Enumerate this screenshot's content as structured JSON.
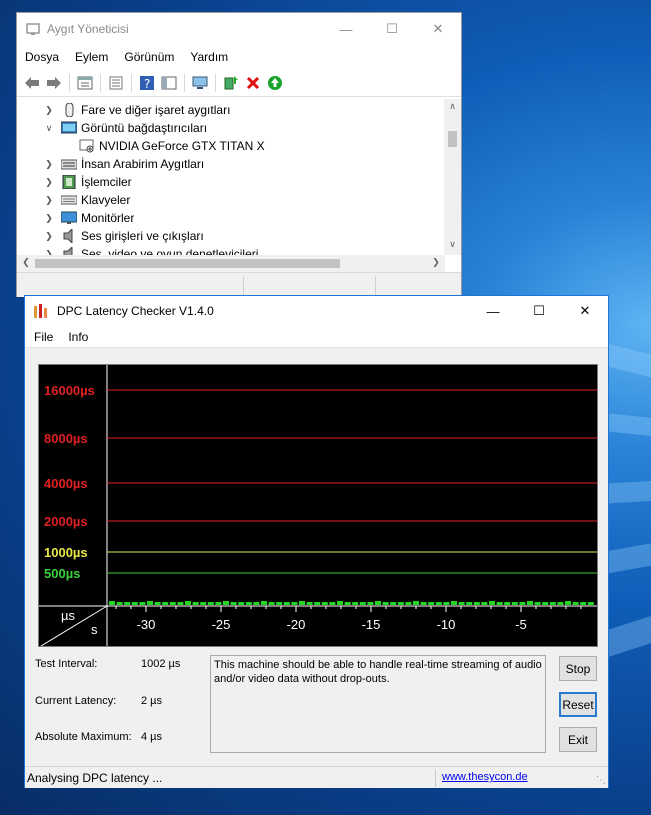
{
  "colors": {
    "accent": "#1d76d6",
    "grid_red": "#e02020",
    "grid_yellow": "#e8e84a",
    "grid_green": "#3ad13a",
    "bar_green": "#22d622"
  },
  "device_manager": {
    "title": "Aygıt Yöneticisi",
    "menu": [
      "Dosya",
      "Eylem",
      "Görünüm",
      "Yardım"
    ],
    "tree": [
      {
        "label": "Fare ve diğer işaret aygıtları",
        "expanded": false,
        "indent": 0,
        "icon": "mouse-icon"
      },
      {
        "label": "Görüntü bağdaştırıcıları",
        "expanded": true,
        "indent": 0,
        "icon": "display-adapter-icon"
      },
      {
        "label": "NVIDIA GeForce GTX TITAN X",
        "expanded": null,
        "indent": 1,
        "icon": "gpu-device-icon"
      },
      {
        "label": "İnsan Arabirim Aygıtları",
        "expanded": false,
        "indent": 0,
        "icon": "hid-icon"
      },
      {
        "label": "İşlemciler",
        "expanded": false,
        "indent": 0,
        "icon": "processor-icon"
      },
      {
        "label": "Klavyeler",
        "expanded": false,
        "indent": 0,
        "icon": "keyboard-icon"
      },
      {
        "label": "Monitörler",
        "expanded": false,
        "indent": 0,
        "icon": "monitor-icon"
      },
      {
        "label": "Ses girişleri ve çıkışları",
        "expanded": false,
        "indent": 0,
        "icon": "audio-icon"
      },
      {
        "label": "Ses, video ve oyun denetleyicileri",
        "expanded": false,
        "indent": 0,
        "icon": "speaker-icon"
      }
    ]
  },
  "dpc": {
    "title": "DPC Latency Checker V1.4.0",
    "menu": [
      "File",
      "Info"
    ],
    "graph": {
      "y_levels": [
        {
          "label": "16000µs",
          "color": "red"
        },
        {
          "label": "8000µs",
          "color": "red"
        },
        {
          "label": "4000µs",
          "color": "red"
        },
        {
          "label": "2000µs",
          "color": "red"
        },
        {
          "label": "1000µs",
          "color": "yellow"
        },
        {
          "label": "500µs",
          "color": "green"
        }
      ],
      "x_ticks": [
        "-30",
        "-25",
        "-20",
        "-15",
        "-10",
        "-5"
      ],
      "unit_y": "µs",
      "unit_x": "s"
    },
    "stats": {
      "test_interval_label": "Test Interval:",
      "test_interval_value": "1002 µs",
      "current_latency_label": "Current Latency:",
      "current_latency_value": "2 µs",
      "absolute_maximum_label": "Absolute Maximum:",
      "absolute_maximum_value": "4 µs"
    },
    "message": "This machine should be able to handle real-time streaming of audio and/or video data without drop-outs.",
    "buttons": {
      "stop": "Stop",
      "reset": "Reset",
      "exit": "Exit"
    },
    "status": {
      "text": "Analysing DPC latency ...",
      "link": "www.thesycon.de"
    }
  }
}
